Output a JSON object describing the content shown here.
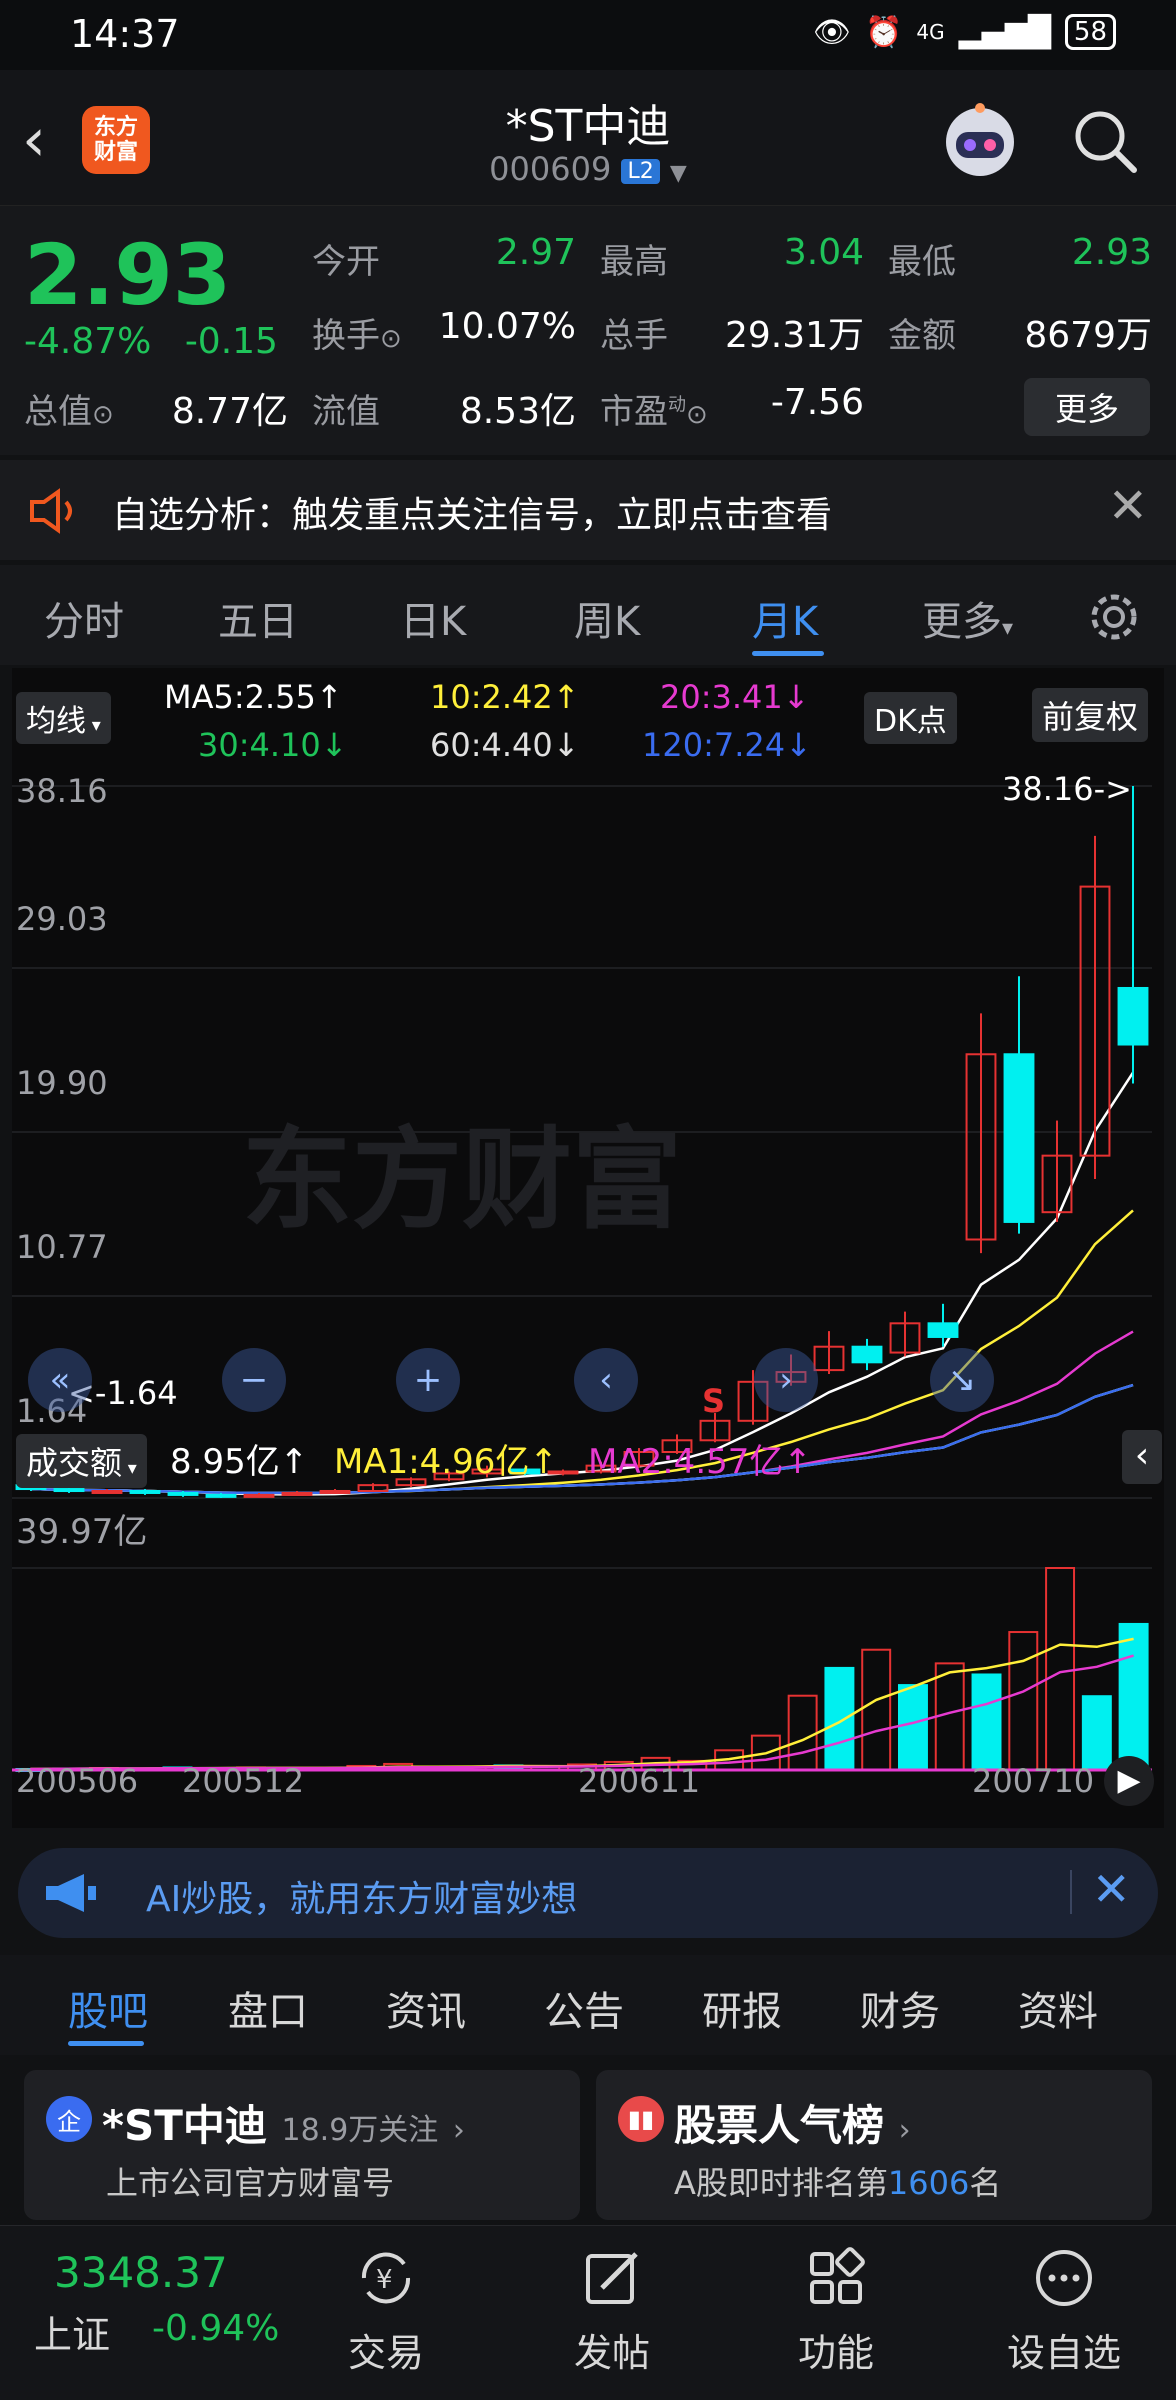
{
  "status": {
    "time": "14:37",
    "signal": "4G",
    "battery": "58"
  },
  "header": {
    "back_icon": "chevron-left-icon",
    "logo_line1": "东方",
    "logo_line2": "财富",
    "title": "*ST中迪",
    "code": "000609",
    "level": "L2",
    "search_icon": "search-icon"
  },
  "quote": {
    "price": "2.93",
    "change_pct": "-4.87%",
    "change_abs": "-0.15",
    "open_label": "今开",
    "open": "2.97",
    "high_label": "最高",
    "high": "3.04",
    "low_label": "最低",
    "low": "2.93",
    "turnover_label": "换手",
    "turnover": "10.07%",
    "volume_label": "总手",
    "volume": "29.31万",
    "amount_label": "金额",
    "amount": "8679万",
    "mktcap_label": "总值",
    "mktcap": "8.77亿",
    "float_label": "流值",
    "float_cap": "8.53亿",
    "pe_label": "市盈",
    "pe_sup": "动",
    "pe": "-7.56",
    "more": "更多"
  },
  "alert": {
    "text": "自选分析：触发重点关注信号，立即点击查看"
  },
  "ktabs": [
    "分时",
    "五日",
    "日K",
    "周K",
    "月K",
    "更多"
  ],
  "ma": {
    "selector": "均线",
    "ma5": "MA5:2.55↑",
    "ma10": "10:2.42↑",
    "ma20": "20:3.41↓",
    "ma30": "30:4.10↓",
    "ma60": "60:4.40↓",
    "ma120": "120:7.24↓",
    "dk": "DK点",
    "adjust": "前复权"
  },
  "price_axis": [
    "38.16",
    "29.03",
    "19.90",
    "10.77",
    "1.64"
  ],
  "markers": {
    "top": "38.16->",
    "bottom": "<-1.64",
    "signal": "S"
  },
  "volume": {
    "selector": "成交额",
    "value": "8.95亿↑",
    "ma1": "MA1:4.96亿↑",
    "ma2": "MA2:4.57亿↑",
    "axis_max": "39.97亿"
  },
  "x_axis": [
    "200506",
    "200512",
    "200611",
    "200710"
  ],
  "watermark": "东方财富",
  "colors": {
    "up": "#e63232",
    "down": "#1fc35a",
    "accent": "#3f8ff0",
    "cyan": "#00f0f0"
  },
  "chart_data": {
    "type": "candlestick",
    "x": [
      "200506",
      "200507",
      "200508",
      "200509",
      "200510",
      "200511",
      "200512",
      "200601",
      "200602",
      "200603",
      "200604",
      "200605",
      "200606",
      "200607",
      "200608",
      "200609",
      "200610",
      "200611",
      "200612",
      "200701",
      "200702",
      "200703",
      "200704",
      "200705",
      "200706",
      "200707",
      "200708",
      "200709",
      "200710",
      "200711"
    ],
    "series": [
      {
        "open": [
          2.3,
          2.1,
          2.0,
          2.0,
          1.9,
          1.8,
          1.7,
          1.8,
          1.9,
          2.0,
          2.3,
          2.6,
          2.9,
          3.1,
          2.9,
          3.0,
          3.3,
          4.0,
          4.6,
          5.6,
          7.6,
          8.2,
          9.4,
          9.1,
          10.6,
          14.9,
          24.4,
          16.3,
          19.2,
          27.8
        ],
        "close": [
          2.1,
          2.0,
          2.0,
          1.9,
          1.8,
          1.7,
          1.8,
          1.9,
          2.0,
          2.3,
          2.6,
          2.9,
          3.1,
          2.9,
          3.0,
          3.3,
          4.0,
          4.6,
          5.6,
          7.6,
          8.1,
          9.4,
          8.6,
          10.6,
          9.9,
          24.4,
          15.8,
          19.2,
          33.0,
          24.9
        ],
        "high": [
          2.4,
          2.2,
          2.1,
          2.1,
          2.0,
          1.9,
          1.9,
          2.0,
          2.1,
          2.4,
          2.7,
          3.0,
          3.3,
          3.2,
          3.1,
          3.5,
          4.2,
          4.9,
          6.0,
          8.2,
          9.0,
          10.2,
          9.8,
          11.2,
          11.6,
          26.5,
          28.4,
          21.0,
          35.6,
          38.16
        ],
        "low": [
          2.0,
          1.9,
          1.9,
          1.8,
          1.7,
          1.64,
          1.66,
          1.75,
          1.85,
          1.95,
          2.2,
          2.5,
          2.7,
          2.8,
          2.8,
          2.9,
          3.2,
          3.9,
          4.5,
          5.4,
          7.4,
          8.0,
          8.2,
          8.9,
          9.4,
          14.2,
          15.2,
          15.8,
          18.0,
          22.9
        ]
      }
    ],
    "ma_lines": [
      "MA5",
      "MA10",
      "MA20",
      "MA30",
      "MA60",
      "MA120"
    ],
    "ylim": [
      1.64,
      38.16
    ],
    "volume_values": [
      0.2,
      0.3,
      0.4,
      0.3,
      0.5,
      0.4,
      0.5,
      0.4,
      0.3,
      0.8,
      1.2,
      0.5,
      0.6,
      0.9,
      0.7,
      1.1,
      1.6,
      2.4,
      1.8,
      3.9,
      6.8,
      14.7,
      20.2,
      23.8,
      16.8,
      21.1,
      18.9,
      27.3,
      39.97,
      14.6,
      28.9
    ],
    "volume_ylim": [
      0,
      39.97
    ]
  },
  "ai_banner": {
    "text": "AI炒股，就用东方财富妙想"
  },
  "btabs": [
    "股吧",
    "盘口",
    "资讯",
    "公告",
    "研报",
    "财务",
    "资料"
  ],
  "cards": [
    {
      "badge": "企",
      "title": "*ST中迪",
      "sub": "18.9万关注",
      "line2": "上市公司官方财富号"
    },
    {
      "badge": "榜",
      "title": "股票人气榜",
      "line2_a": "A股即时排名第",
      "rank": "1606",
      "line2_b": "名"
    }
  ],
  "nav": {
    "index_value": "3348.37",
    "index_name": "上证",
    "index_change": "-0.94%",
    "items": [
      "交易",
      "发帖",
      "功能",
      "设自选"
    ]
  }
}
